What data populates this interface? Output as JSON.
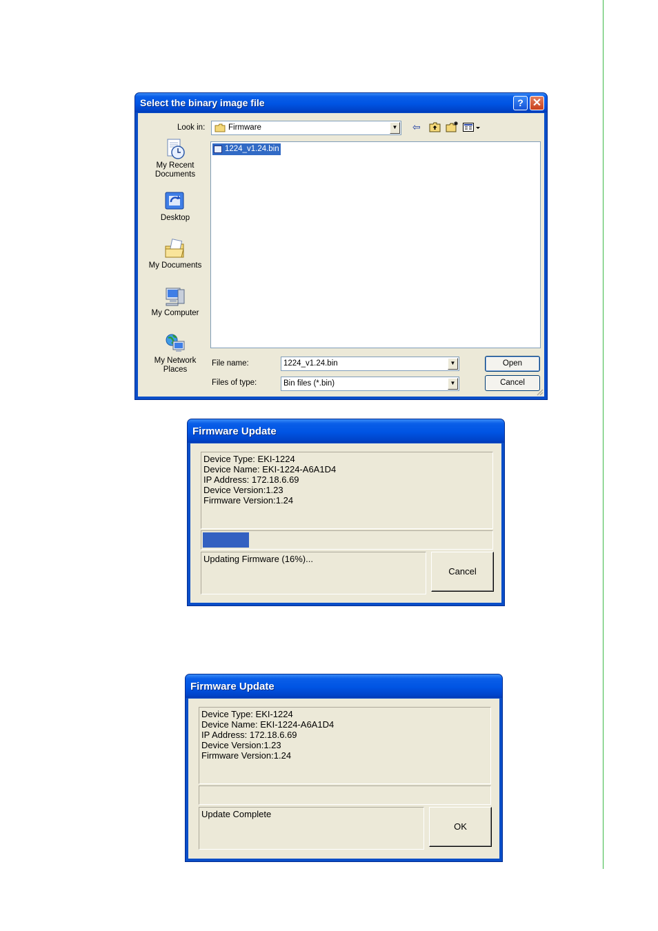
{
  "file_dialog": {
    "title": "Select the binary image file",
    "look_in_label": "Look in:",
    "look_in_value": "Firmware",
    "places": [
      {
        "label_1": "My Recent",
        "label_2": "Documents",
        "icon": "recent-documents-icon"
      },
      {
        "label_1": "Desktop",
        "label_2": "",
        "icon": "desktop-icon"
      },
      {
        "label_1": "My Documents",
        "label_2": "",
        "icon": "my-documents-icon"
      },
      {
        "label_1": "My Computer",
        "label_2": "",
        "icon": "my-computer-icon"
      },
      {
        "label_1": "My Network",
        "label_2": "Places",
        "icon": "network-places-icon"
      }
    ],
    "files": [
      "1224_v1.24.bin"
    ],
    "file_name_label": "File name:",
    "file_name_value": "1224_v1.24.bin",
    "file_type_label": "Files of type:",
    "file_type_value": "Bin files (*.bin)",
    "open_label": "Open",
    "cancel_label": "Cancel",
    "help_glyph": "?",
    "close_glyph": "✕"
  },
  "update_dialog_progress": {
    "title": "Firmware Update",
    "info": [
      "Device Type: EKI-1224",
      "Device Name: EKI-1224-A6A1D4",
      "IP Address: 172.18.6.69",
      "Device Version:1.23",
      "Firmware Version:1.24"
    ],
    "progress": 0.16,
    "status": "Updating Firmware (16%)...",
    "button_label": "Cancel",
    "progress_color": "#3461c1"
  },
  "update_dialog_complete": {
    "title": "Firmware Update",
    "info": [
      "Device Type: EKI-1224",
      "Device Name: EKI-1224-A6A1D4",
      "IP Address: 172.18.6.69",
      "Device Version:1.23",
      "Firmware Version:1.24"
    ],
    "progress": 0,
    "status": "Update Complete",
    "button_label": "OK"
  },
  "colors": {
    "title_bar_blue": "#0054e3",
    "dialog_face": "#ece9d8",
    "page_rule_green": "#3cb846",
    "selection_blue": "#316ac5"
  }
}
